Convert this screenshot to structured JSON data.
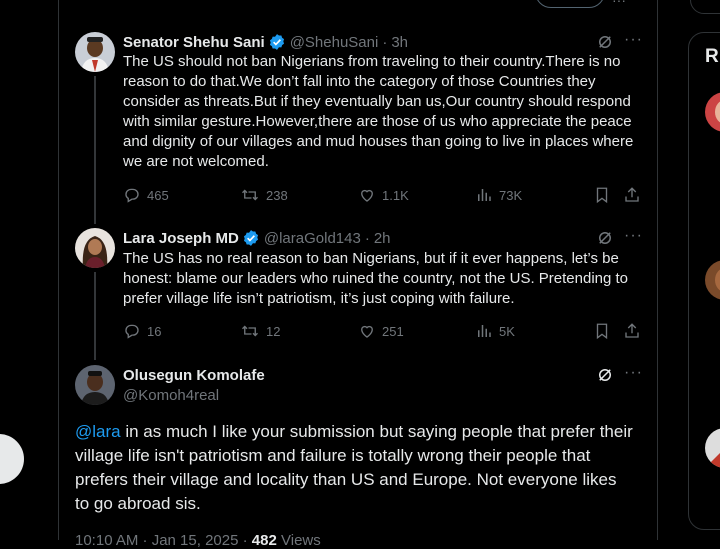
{
  "tweets": [
    {
      "name": "Senator Shehu Sani",
      "handle": "@ShehuSani",
      "time": "3h",
      "text": "The US should not ban Nigerians from traveling to their country.There is no reason to do that.We don’t fall into the category of those Countries they consider as threats.But if they eventually ban us,Our country should respond with similar gesture.However,there are those of us who appreciate the peace and dignity of our villages and mud houses than going to live in places where we are not welcomed.",
      "replies": "465",
      "reposts": "238",
      "likes": "1.1K",
      "views": "73K"
    },
    {
      "name": "Lara Joseph MD",
      "handle": "@laraGold143",
      "time": "2h",
      "text": "The US has no real reason to ban Nigerians, but if it ever happens, let’s be honest: blame our leaders who ruined the country, not the US. Pretending to prefer village life isn’t patriotism, it’s just coping with failure.",
      "replies": "16",
      "reposts": "12",
      "likes": "251",
      "views": "5K"
    }
  ],
  "main_tweet": {
    "name": "Olusegun Komolafe",
    "handle": "@Komoh4real",
    "mention": "@lara",
    "text": " in as much I like your submission but saying people that prefer their village life isn't patriotism and failure is totally wrong their people that prefers their village and locality than US and Europe. Not everyone likes to go abroad sis.",
    "footer_time": "10:10 AM · Jan 15, 2025 ·",
    "footer_views_count": "482",
    "footer_views_label": "Views"
  },
  "sidebar": {
    "title": "R"
  },
  "colors": {
    "background": "#000000",
    "text": "#e7e9ea",
    "muted": "#71767b",
    "accent": "#1d9bf0",
    "border": "#2f3336"
  },
  "icons": [
    "verified-badge-icon",
    "grok-icon",
    "more-icon",
    "reply-icon",
    "repost-icon",
    "like-icon",
    "views-icon",
    "bookmark-icon",
    "share-icon"
  ]
}
